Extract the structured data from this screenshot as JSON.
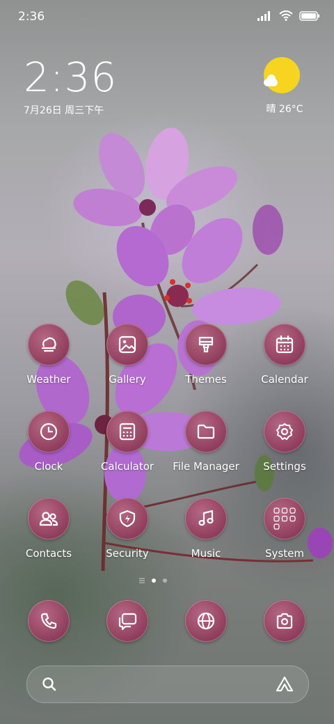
{
  "status_bar": {
    "time": "2:36"
  },
  "clock_widget": {
    "time": "2:36",
    "date": "7月26日 周三下午"
  },
  "weather_widget": {
    "text": "晴 26°C"
  },
  "apps": [
    {
      "label": "Weather",
      "icon": "weather-icon"
    },
    {
      "label": "Gallery",
      "icon": "gallery-icon"
    },
    {
      "label": "Themes",
      "icon": "themes-icon"
    },
    {
      "label": "Calendar",
      "icon": "calendar-icon"
    },
    {
      "label": "Clock",
      "icon": "clock-icon"
    },
    {
      "label": "Calculator",
      "icon": "calculator-icon"
    },
    {
      "label": "File Manager",
      "icon": "folder-icon"
    },
    {
      "label": "Settings",
      "icon": "gear-icon"
    },
    {
      "label": "Contacts",
      "icon": "contacts-icon"
    },
    {
      "label": "Security",
      "icon": "shield-icon"
    },
    {
      "label": "Music",
      "icon": "music-icon"
    },
    {
      "label": "System",
      "icon": "folder-grid-icon"
    }
  ],
  "dock": [
    {
      "icon": "phone-icon"
    },
    {
      "icon": "messages-icon"
    },
    {
      "icon": "browser-icon"
    },
    {
      "icon": "camera-icon"
    }
  ],
  "page_indicator": {
    "pages": 2,
    "current": 1
  },
  "colors": {
    "icon_bg": "#9a4566",
    "sun": "#f7d41f"
  }
}
